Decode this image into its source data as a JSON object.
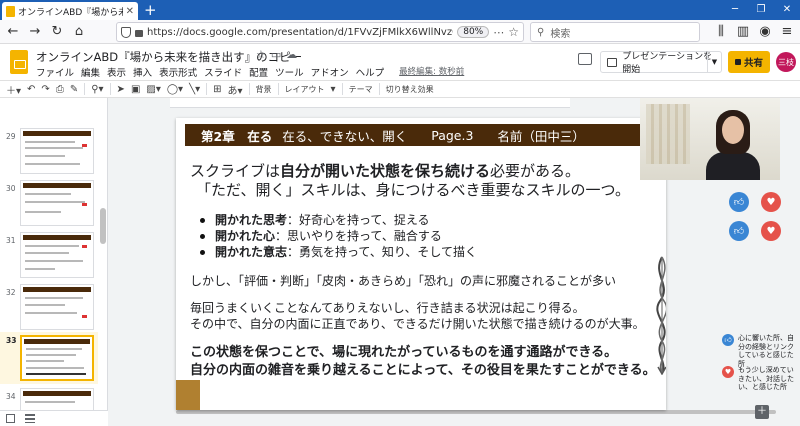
{
  "browser": {
    "tab_title": "オンラインABD『場から未来を描き出",
    "url": "https://docs.google.com/presentation/d/1FVvZjFMlkX6WllNvzGOGe4z",
    "zoom": "80%",
    "search_placeholder": "検索"
  },
  "docs": {
    "title": "オンラインABD『場から未来を描き出す』のコピー",
    "menu": [
      "ファイル",
      "編集",
      "表示",
      "挿入",
      "表示形式",
      "スライド",
      "配置",
      "ツール",
      "アドオン",
      "ヘルプ"
    ],
    "last_edit": "最終編集: 数秒前",
    "present_label": "プレゼンテーションを開始",
    "share_label": "共有",
    "avatar_label": "三枝"
  },
  "toolbar": {
    "background": "背景",
    "layout": "レイアウト",
    "theme": "テーマ",
    "transition": "切り替え効果"
  },
  "filmstrip": {
    "slides": [
      {
        "num": "29"
      },
      {
        "num": "30"
      },
      {
        "num": "31"
      },
      {
        "num": "32"
      },
      {
        "num": "33"
      },
      {
        "num": "34"
      }
    ],
    "selected": "33"
  },
  "slide": {
    "header_chapter": "第2章　在る",
    "header_sub": "在る、できない、開く",
    "header_page": "Page.3",
    "header_name": "名前（田中三）",
    "line1_pre": "スクライブは",
    "line1_bold": "自分が開いた状態を保ち続ける",
    "line1_post": "必要がある。",
    "line2": "「ただ、開く」スキルは、身につけるべき重要なスキルの一つ。",
    "bullets": [
      {
        "bold": "開かれた思考",
        "rest": "：好奇心を持って、捉える"
      },
      {
        "bold": "開かれた心",
        "rest": "：思いやりを持って、融合する"
      },
      {
        "bold": "開かれた意志",
        "rest": "：勇気を持って、知り、そして描く"
      }
    ],
    "line3": "しかし、「評価・判断」「皮肉・あきらめ」「恐れ」の声に邪魔されることが多い",
    "line4a": "毎回うまくいくことなんてありえないし、行き詰まる状況は起こり得る。",
    "line4b": "その中で、自分の内面に正直であり、できるだけ開いた状態で描き続けるのが大事。",
    "line5a": "この状態を保つことで、場に現れたがっているものを通す通路ができる。",
    "line5b": "自分の内面の雑音を乗り越えることによって、その役目を果たすことができる。"
  },
  "reactions": {
    "like_caption": "心に響いた所、自分の経験とリンクしていると感じた所",
    "heart_caption": "もう少し深めていきたい、対話したい、と感じた所"
  },
  "colors": {
    "header_brown": "#4a2a0a",
    "slides_yellow": "#f4b400",
    "browser_blue": "#1d5fb5",
    "like_blue": "#3a86d4",
    "heart_red": "#e5524a"
  }
}
